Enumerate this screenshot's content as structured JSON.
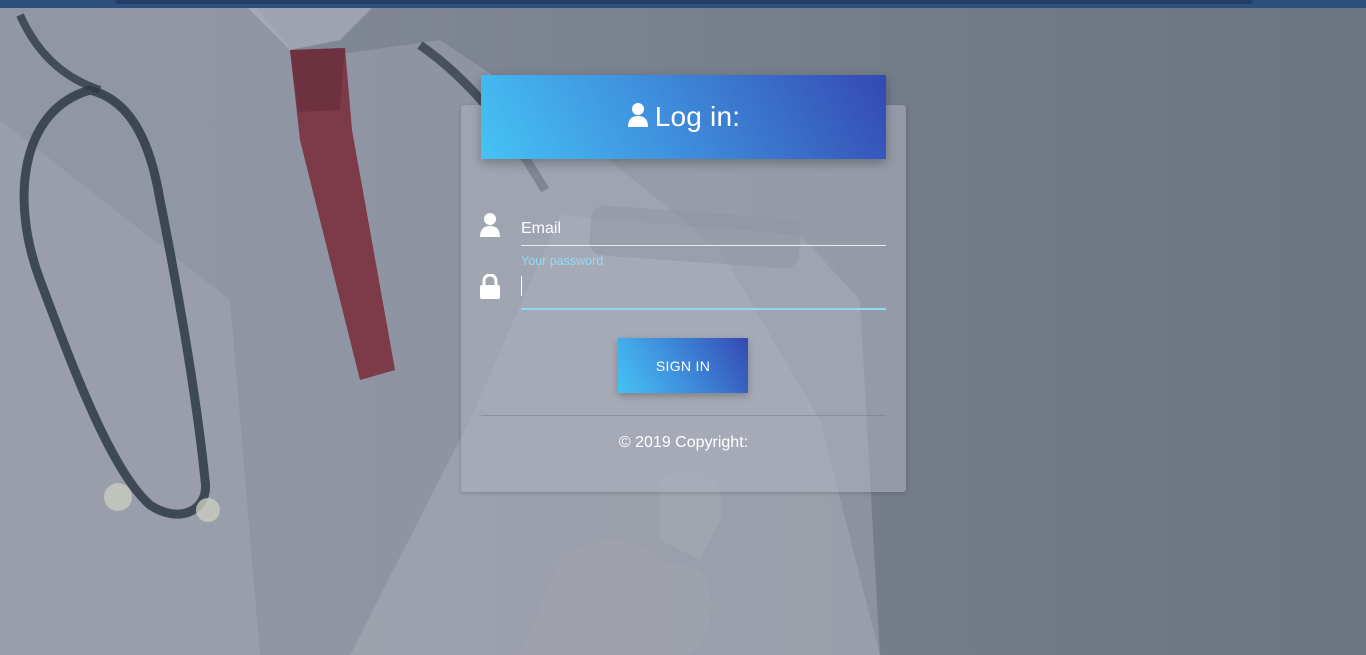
{
  "header": {
    "title": "Log in:",
    "icon": "user-icon"
  },
  "form": {
    "email_label": "Email",
    "email_icon": "user-icon",
    "password_label": "Your password",
    "password_value": "",
    "password_icon": "lock-icon"
  },
  "actions": {
    "signin_label": "SIGN IN"
  },
  "footer": {
    "copyright": "© 2019 Copyright:"
  },
  "colors": {
    "accent_start": "#45c3f4",
    "accent_end": "#3449b4",
    "focus_underline": "#8fd9f7"
  }
}
